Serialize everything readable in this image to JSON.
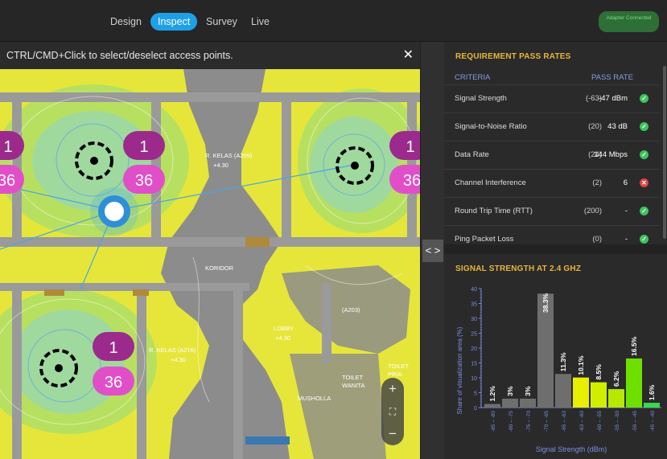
{
  "topbar": {
    "tabs": [
      {
        "label": "Design",
        "active": false
      },
      {
        "label": "Inspect",
        "active": true
      },
      {
        "label": "Survey",
        "active": false
      },
      {
        "label": "Live",
        "active": false
      }
    ],
    "status_badge": "Adapter Connected"
  },
  "map": {
    "hint": "CTRL/CMD+Click to select/deselect access points.",
    "close_icon": "close-icon",
    "room_labels": [
      "R. KELAS (A209)",
      "+4.30",
      "KORIDOR",
      "R. KELAS (A216)",
      "+4.30",
      "LOBBY",
      "+4.30",
      "(A203)",
      "TOILET",
      "WANITA",
      "MUSHOLLA",
      "TOILET",
      "PRIA"
    ],
    "access_points": [
      {
        "channel_top": "1",
        "channel_bottom": "36"
      },
      {
        "channel_top": "1",
        "channel_bottom": "36"
      },
      {
        "channel_top": "1",
        "channel_bottom": "36"
      },
      {
        "channel_top": "1",
        "channel_bottom": "36"
      }
    ],
    "zoom": {
      "in": "+",
      "fit": "⛶",
      "out": "−"
    }
  },
  "divider": {
    "toggle": "< >"
  },
  "requirements": {
    "title": "REQUIREMENT PASS RATES",
    "col_criteria": "CRITERIA",
    "col_pass": "PASS RATE",
    "rows": [
      {
        "label": "Signal Strength",
        "ref": "(-63)",
        "value": "-47 dBm",
        "status": "pass"
      },
      {
        "label": "Signal-to-Noise Ratio",
        "ref": "(20)",
        "value": "43 dB",
        "status": "pass"
      },
      {
        "label": "Data Rate",
        "ref": "(24)",
        "value": "144 Mbps",
        "status": "pass"
      },
      {
        "label": "Channel Interference",
        "ref": "(2)",
        "value": "6",
        "status": "fail"
      },
      {
        "label": "Round Trip Time (RTT)",
        "ref": "(200)",
        "value": "-",
        "status": "pass"
      },
      {
        "label": "Ping Packet Loss",
        "ref": "(0)",
        "value": "-",
        "status": "pass"
      }
    ]
  },
  "chart_section": {
    "title": "SIGNAL STRENGTH AT 2.4 GHZ"
  },
  "chart_data": {
    "type": "bar",
    "xlabel": "Signal Strength (dBm)",
    "ylabel": "Share of visualization area (%)",
    "ylim": [
      0,
      40
    ],
    "yticks": [
      0,
      5,
      10,
      15,
      20,
      25,
      30,
      35,
      40
    ],
    "categories": [
      "-85 – -80",
      "-80 – -75",
      "-75 – -70",
      "-70 – -65",
      "-65 – -63",
      "-63 – -60",
      "-60 – -55",
      "-55 – -50",
      "-50 – -45",
      "-45 – -40"
    ],
    "values": [
      1.2,
      3,
      3,
      38.3,
      11.3,
      10.1,
      8.5,
      6.2,
      16.5,
      1.6
    ],
    "labels": [
      "1.2%",
      "3%",
      "3%",
      "38.3%",
      "11.3%",
      "10.1%",
      "8.5%",
      "6.2%",
      "16.5%",
      "1.6%"
    ],
    "colors": [
      "#6e6e6e",
      "#6e6e6e",
      "#6e6e6e",
      "#6e6e6e",
      "#6e6e6e",
      "#e8f000",
      "#d2ee00",
      "#b6e800",
      "#6ee000",
      "#3ed84a"
    ]
  }
}
